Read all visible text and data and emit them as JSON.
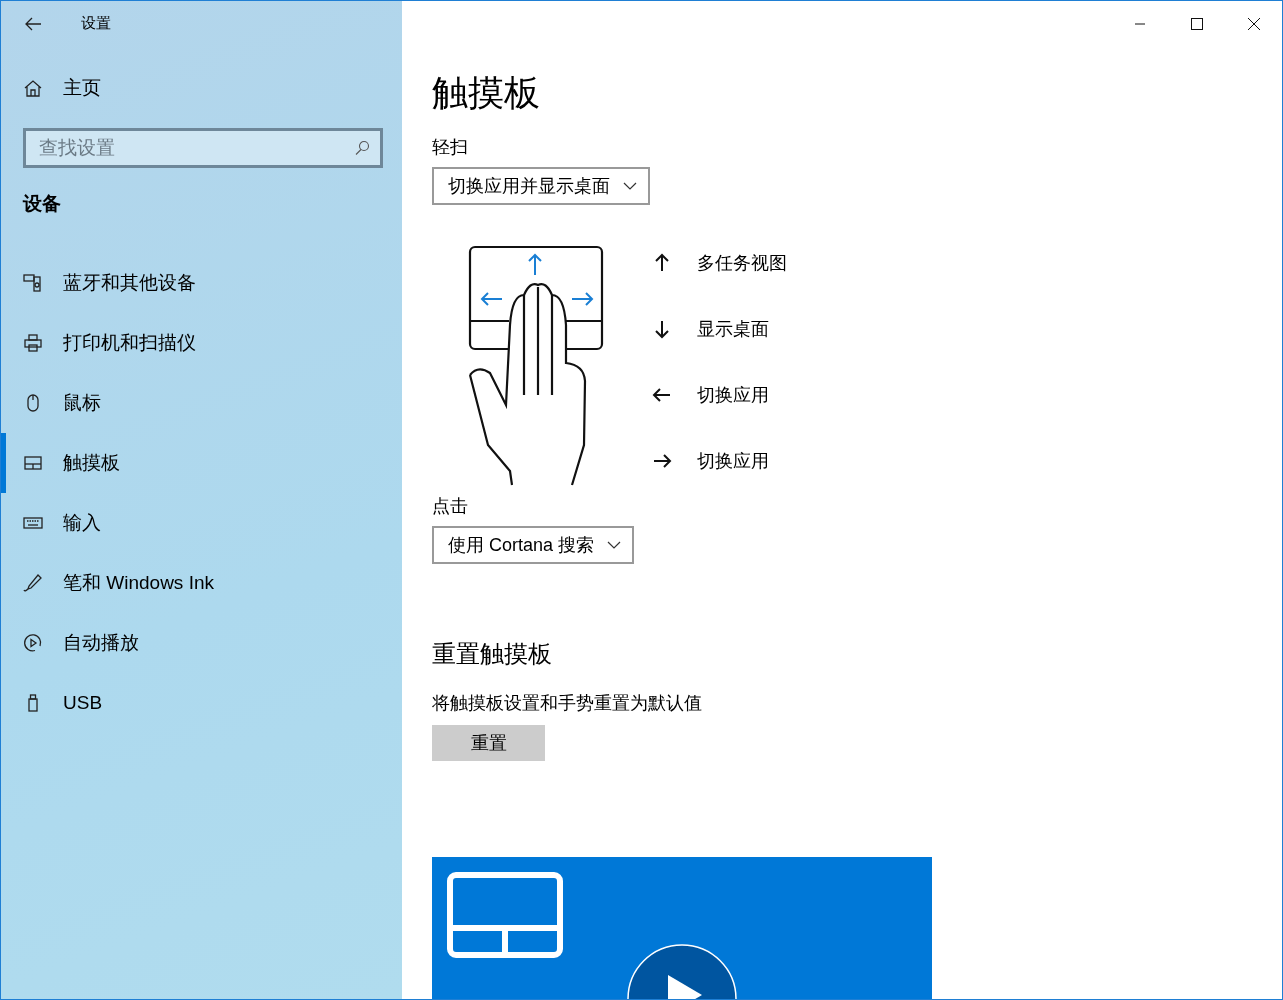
{
  "window": {
    "title": "设置"
  },
  "sidebar": {
    "home": "主页",
    "search": {
      "placeholder": "查找设置"
    },
    "section": "设备",
    "items": [
      {
        "label": "蓝牙和其他设备",
        "kind": "bluetooth",
        "selected": false
      },
      {
        "label": "打印机和扫描仪",
        "kind": "printer",
        "selected": false
      },
      {
        "label": "鼠标",
        "kind": "mouse",
        "selected": false
      },
      {
        "label": "触摸板",
        "kind": "touchpad",
        "selected": true
      },
      {
        "label": "输入",
        "kind": "keyboard",
        "selected": false
      },
      {
        "label": "笔和 Windows Ink",
        "kind": "pen",
        "selected": false
      },
      {
        "label": "自动播放",
        "kind": "autoplay",
        "selected": false
      },
      {
        "label": "USB",
        "kind": "usb",
        "selected": false
      }
    ]
  },
  "page": {
    "title": "触摸板",
    "swipe": {
      "label": "轻扫",
      "value": "切换应用并显示桌面"
    },
    "gestures": [
      {
        "kind": "up",
        "label": "多任务视图"
      },
      {
        "kind": "down",
        "label": "显示桌面"
      },
      {
        "kind": "left",
        "label": "切换应用"
      },
      {
        "kind": "right",
        "label": "切换应用"
      }
    ],
    "tap": {
      "label": "点击",
      "value": "使用 Cortana 搜索"
    },
    "reset": {
      "heading": "重置触摸板",
      "description": "将触摸板设置和手势重置为默认值",
      "button": "重置"
    }
  }
}
